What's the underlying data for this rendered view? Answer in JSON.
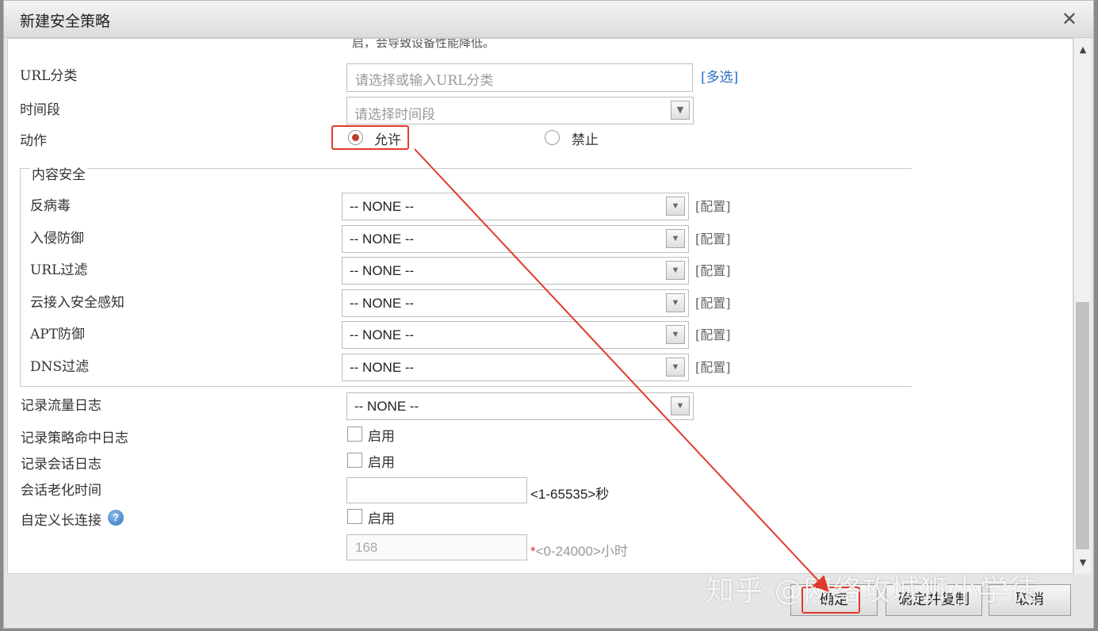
{
  "dialog": {
    "title": "新建安全策略",
    "close_glyph": "✕"
  },
  "form": {
    "truncated_note": "启，会导致设备性能降低。",
    "url_category": {
      "label": "URL分类",
      "placeholder": "请选择或输入URL分类",
      "multi_label": "[多选]"
    },
    "time_range": {
      "label": "时间段",
      "placeholder": "请选择时间段"
    },
    "action": {
      "label": "动作",
      "options": [
        "允许",
        "禁止"
      ],
      "selected": "允许"
    },
    "content_security": {
      "legend": "内容安全",
      "config_label": "[配置]",
      "rows": [
        {
          "label": "反病毒",
          "value": "-- NONE --"
        },
        {
          "label": "入侵防御",
          "value": "-- NONE --"
        },
        {
          "label": "URL过滤",
          "value": "-- NONE --"
        },
        {
          "label": "云接入安全感知",
          "value": "-- NONE --"
        },
        {
          "label": "APT防御",
          "value": "-- NONE --"
        },
        {
          "label": "DNS过滤",
          "value": "-- NONE --"
        }
      ]
    },
    "traffic_log": {
      "label": "记录流量日志",
      "value": "-- NONE --"
    },
    "policy_hit_log": {
      "label": "记录策略命中日志",
      "checkbox_label": "启用",
      "checked": false
    },
    "session_log": {
      "label": "记录会话日志",
      "checkbox_label": "启用",
      "checked": false
    },
    "session_aging": {
      "label": "会话老化时间",
      "value": "",
      "hint": "<1-65535>秒"
    },
    "custom_long_conn": {
      "label": "自定义长连接",
      "checkbox_label": "启用",
      "checked": false,
      "hours_value": "168",
      "hours_required": "*",
      "hours_hint": "<0-24000>小时"
    }
  },
  "buttons": {
    "ok": "确定",
    "ok_copy": "确定并复制",
    "cancel": "取消"
  },
  "watermark": "知乎 @网络攻城狮小学徒",
  "colors": {
    "annotation": "#e03a2c",
    "link": "#2a6fc9"
  }
}
